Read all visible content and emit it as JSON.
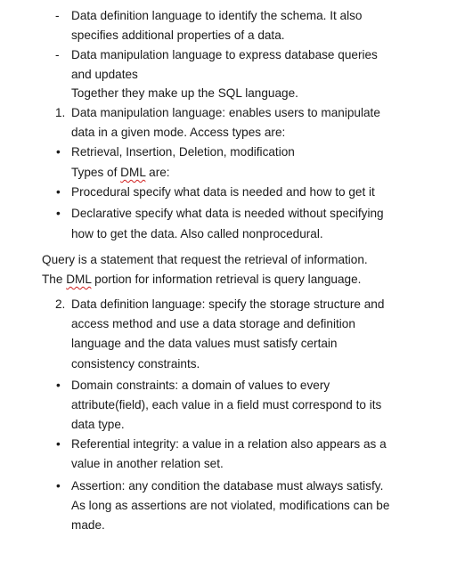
{
  "document": {
    "lines": [
      {
        "marker": "-",
        "indent": "list",
        "text": "Data definition language to identify the schema. It also"
      },
      {
        "marker": "",
        "indent": "list",
        "text": "specifies additional properties of a data."
      },
      {
        "marker": "-",
        "indent": "list",
        "text": "Data manipulation language to express database queries"
      },
      {
        "marker": "",
        "indent": "list",
        "text": "and updates"
      },
      {
        "marker": "",
        "indent": "list",
        "text": "Together they make up the SQL language."
      },
      {
        "marker": "1.",
        "indent": "list",
        "text": "Data manipulation language: enables users to manipulate"
      },
      {
        "marker": "",
        "indent": "list",
        "text": "data in a given mode. Access types are:"
      },
      {
        "marker": "•",
        "indent": "list",
        "text": "Retrieval, Insertion, Deletion, modification"
      },
      {
        "marker": "",
        "indent": "list",
        "text": "Types of DML are:",
        "spell": "DML"
      },
      {
        "marker": "•",
        "indent": "list",
        "text": "Procedural specify what data is needed and how to get it"
      },
      {
        "marker": "•",
        "indent": "list",
        "text": "Declarative specify what data is needed without specifying"
      },
      {
        "marker": "",
        "indent": "list",
        "text": "how to get the data. Also called nonprocedural."
      },
      {
        "marker": "",
        "indent": "body",
        "text": "Query is a statement that request the retrieval of information."
      },
      {
        "marker": "",
        "indent": "body",
        "text": "The DML portion for information retrieval is query language.",
        "spell": "DML"
      },
      {
        "marker": "2.",
        "indent": "list",
        "text": "Data definition language: specify the storage structure and"
      },
      {
        "marker": "",
        "indent": "list",
        "text": "access method and use a data storage and definition"
      },
      {
        "marker": "",
        "indent": "list",
        "text": "language and the data values must satisfy certain"
      },
      {
        "marker": "",
        "indent": "list",
        "text": "consistency constraints."
      },
      {
        "marker": "•",
        "indent": "list",
        "text": "Domain constraints: a domain of values to every"
      },
      {
        "marker": "",
        "indent": "list",
        "text": "attribute(field), each value in a field must correspond to its"
      },
      {
        "marker": "",
        "indent": "list",
        "text": "data type."
      },
      {
        "marker": "•",
        "indent": "list",
        "text": "Referential integrity: a value in a relation also appears as a"
      },
      {
        "marker": "",
        "indent": "list",
        "text": "value in another relation set."
      },
      {
        "marker": "•",
        "indent": "list",
        "text": "Assertion: any condition the database must always satisfy."
      },
      {
        "marker": "",
        "indent": "list",
        "text": "As long as assertions are not violated, modifications can be"
      },
      {
        "marker": "",
        "indent": "list",
        "text": "made."
      }
    ],
    "spellcheck_color": "#d02020"
  }
}
